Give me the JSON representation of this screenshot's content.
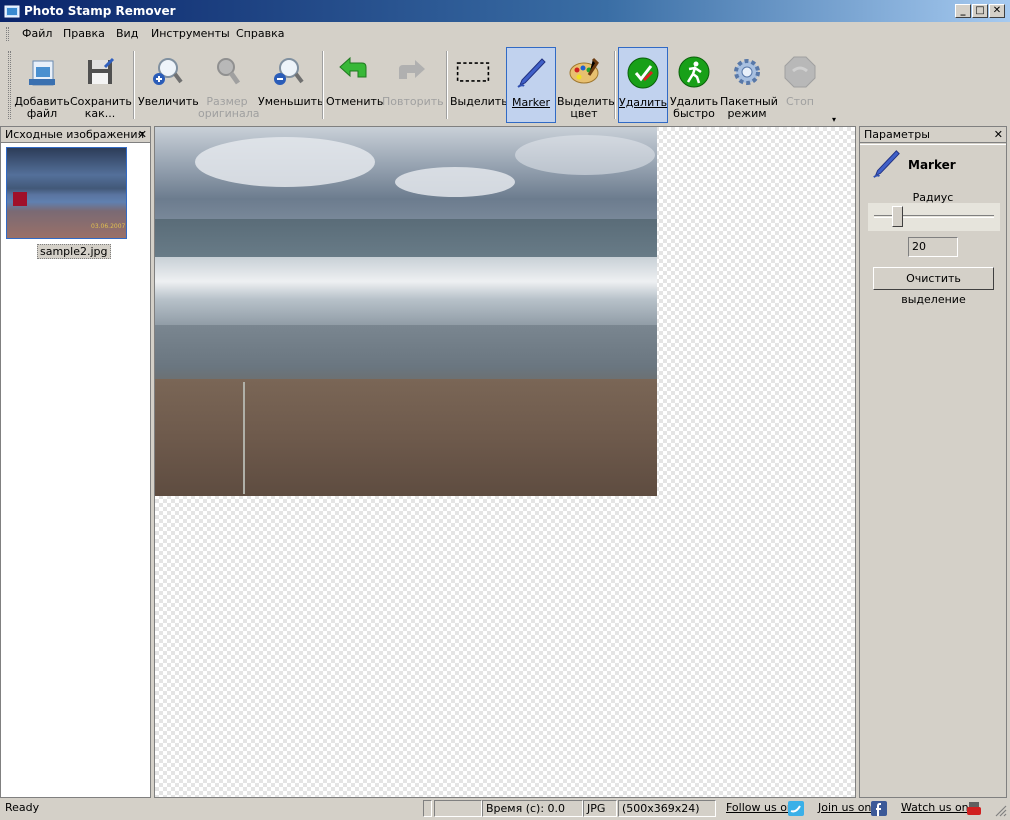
{
  "window": {
    "title": "Photo Stamp Remover"
  },
  "menu": [
    "Файл",
    "Правка",
    "Вид",
    "Инструменты",
    "Справка"
  ],
  "toolbar": {
    "add_file": [
      "Добавить",
      "файл"
    ],
    "save_as": [
      "Сохранить",
      "как..."
    ],
    "zoom_in": [
      "Увеличить"
    ],
    "original_size": [
      "Размер",
      "оригинала"
    ],
    "zoom_out": [
      "Уменьшить"
    ],
    "undo": [
      "Отменить"
    ],
    "redo": [
      "Повторить"
    ],
    "select": [
      "Выделить"
    ],
    "marker": [
      "Marker"
    ],
    "select_color": [
      "Выделить",
      "цвет"
    ],
    "remove": [
      "Удалить"
    ],
    "remove_fast": [
      "Удалить",
      "быстро"
    ],
    "batch_mode": [
      "Пакетный",
      "режим"
    ],
    "stop": [
      "Стоп"
    ],
    "more": "▾"
  },
  "left_panel": {
    "title": "Исходные изображения",
    "close": "✕",
    "thumb_stamp": "03.06.2007",
    "thumb_label": "sample2.jpg"
  },
  "right_panel": {
    "title": "Параметры",
    "close": "✕",
    "tool_name": "Marker",
    "radius_label": "Радиус",
    "radius_value": "20",
    "clear_button": "Очистить выделение"
  },
  "status": {
    "ready": "Ready",
    "time": "Время (с): 0.0",
    "format": "JPG",
    "dimensions": "(500x369x24)",
    "follow": "Follow us on",
    "join": "Join us on",
    "watch": "Watch us on"
  },
  "colors": {
    "title_bar": "#0a246a",
    "active_button": "#c1d2ee",
    "active_border": "#316ac5"
  }
}
